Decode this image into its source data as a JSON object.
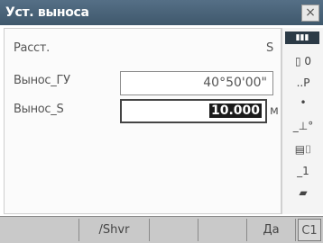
{
  "window": {
    "title": "Уст. выноса",
    "close_label": "×"
  },
  "form": {
    "rows": [
      {
        "label": "Расст.",
        "value": "S"
      },
      {
        "label": "Вынос_ГУ",
        "value": "40°50'00\""
      },
      {
        "label": "Вынос_S",
        "value": "10.000",
        "unit": "м"
      }
    ]
  },
  "side_panel": {
    "icons": [
      {
        "name": "signal-icon",
        "glyph": "▮▮▮"
      },
      {
        "name": "target-icon",
        "glyph": "▯ 0"
      },
      {
        "name": "tilt-icon",
        "glyph": "..P"
      },
      {
        "name": "dot-icon",
        "glyph": "•"
      },
      {
        "name": "horizon-icon",
        "glyph": "_⊥°"
      },
      {
        "name": "memory-icon",
        "glyph": "▤⌷"
      },
      {
        "name": "level-icon",
        "glyph": "_1"
      },
      {
        "name": "battery-icon",
        "glyph": "▰"
      }
    ]
  },
  "softkeys": [
    {
      "label": ""
    },
    {
      "label": "/Shvr"
    },
    {
      "label": ""
    },
    {
      "label": ""
    },
    {
      "label": "Да"
    },
    {
      "label": "С1"
    }
  ]
}
